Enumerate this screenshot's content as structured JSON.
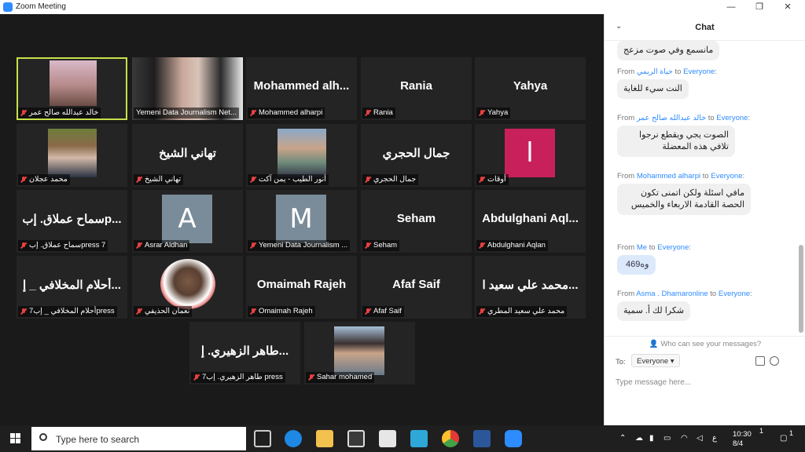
{
  "window": {
    "title": "Zoom Meeting"
  },
  "tiles": [
    {
      "label": "خالد عبدالله صالح عمر",
      "big": ""
    },
    {
      "label": "Yemeni Data Journalism Net...",
      "big": ""
    },
    {
      "label": "Mohammed alharpi",
      "big": "Mohammed  alh..."
    },
    {
      "label": "Rania",
      "big": "Rania"
    },
    {
      "label": "Yahya",
      "big": "Yahya"
    },
    {
      "label": "محمد عجلان",
      "big": ""
    },
    {
      "label": "تهاني الشيخ",
      "big": "تهاني الشيخ"
    },
    {
      "label": "أنور الطيب - يمن آكت",
      "big": ""
    },
    {
      "label": "جمال الحجري",
      "big": "جمال الحجري"
    },
    {
      "label": "أوقات",
      "big": "",
      "avatar": "l"
    },
    {
      "label": "سماح عملاق. إبpress 7",
      "big": "سماح عملاق. إبp..."
    },
    {
      "label": "Asrar Aldhan",
      "big": "",
      "avatar": "A"
    },
    {
      "label": "Yemeni Data Journalism ...",
      "big": "",
      "avatar": "M"
    },
    {
      "label": "Seham",
      "big": "Seham"
    },
    {
      "label": "Abdulghani Aqlan",
      "big": "Abdulghani  Aql..."
    },
    {
      "label": "أحلام المخلافي _ إب7press",
      "big": "أحلام المخلافي _ إ..."
    },
    {
      "label": "نعمان الحذيفي",
      "big": ""
    },
    {
      "label": "Omaimah Rajeh",
      "big": "Omaimah Rajeh"
    },
    {
      "label": "Afaf Saif",
      "big": "Afaf Saif"
    },
    {
      "label": "محمد علي سعيد المطري",
      "big": "محمد علي سعيد ا..."
    },
    {
      "label": "طاهر الزهيري. إب7 press",
      "big": "طاهر الزهيري. إ..."
    },
    {
      "label": "Sahar mohamed",
      "big": ""
    }
  ],
  "chat": {
    "title": "Chat",
    "first_text": "مانسمع وفي صوت مزعج",
    "messages": [
      {
        "from": "حياة الريمي",
        "to": "Everyone",
        "text": "النت سيء للغاية"
      },
      {
        "from": "خالد عبدالله صالح عمر",
        "to": "Everyone",
        "text": "الصوت يجي ويقطع نرجوا تلافي هذه المعضلة"
      },
      {
        "from": "Mohammed alharpi",
        "to": "Everyone",
        "text": "مافي اسئلة ولكن اتمنى تكون الحصة القادمة الاربعاء والخميس"
      },
      {
        "from": "Me",
        "to": "Everyone",
        "text": "‪‬ 469وه"
      },
      {
        "from": "Asma . Dhamaronline",
        "to": "Everyone",
        "text": "شكرا لك أ. سمية"
      }
    ],
    "word_from": "From",
    "word_to": "to",
    "privacy": "Who can see your messages?",
    "to_label": "To:",
    "to_value": "Everyone",
    "placeholder": "Type message here..."
  },
  "taskbar": {
    "search_placeholder": "Type here to search",
    "lang": "ع",
    "time": "10:30",
    "date": "8/4",
    "notif_count": "1",
    "badge": "1"
  },
  "colors": {
    "accent": "#2d8cff",
    "active_border": "#c7e04a",
    "avatar_pink": "#c8205a",
    "avatar_slate": "#7a8c99"
  }
}
